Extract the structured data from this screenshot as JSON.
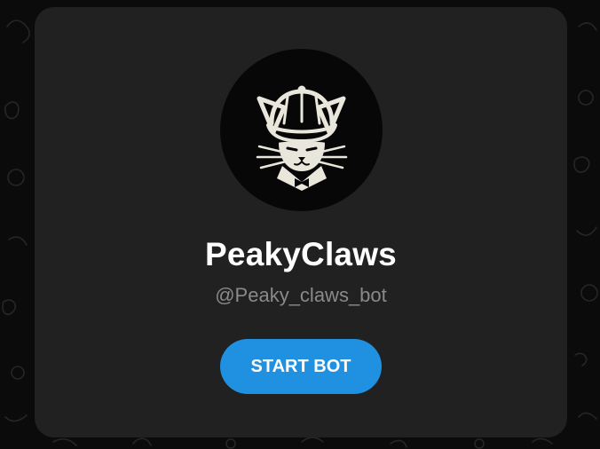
{
  "colors": {
    "background": "#0b0b0b",
    "card": "#212121",
    "accent": "#2090e0",
    "title": "#ffffff",
    "subtitle": "#8a8a8a",
    "avatar_bg": "#070707",
    "logo": "#e9e6dc"
  },
  "bot": {
    "avatar_icon": "cat-in-flat-cap-logo",
    "name": "PeakyClaws",
    "username": "@Peaky_claws_bot"
  },
  "actions": {
    "start_label": "START BOT"
  }
}
